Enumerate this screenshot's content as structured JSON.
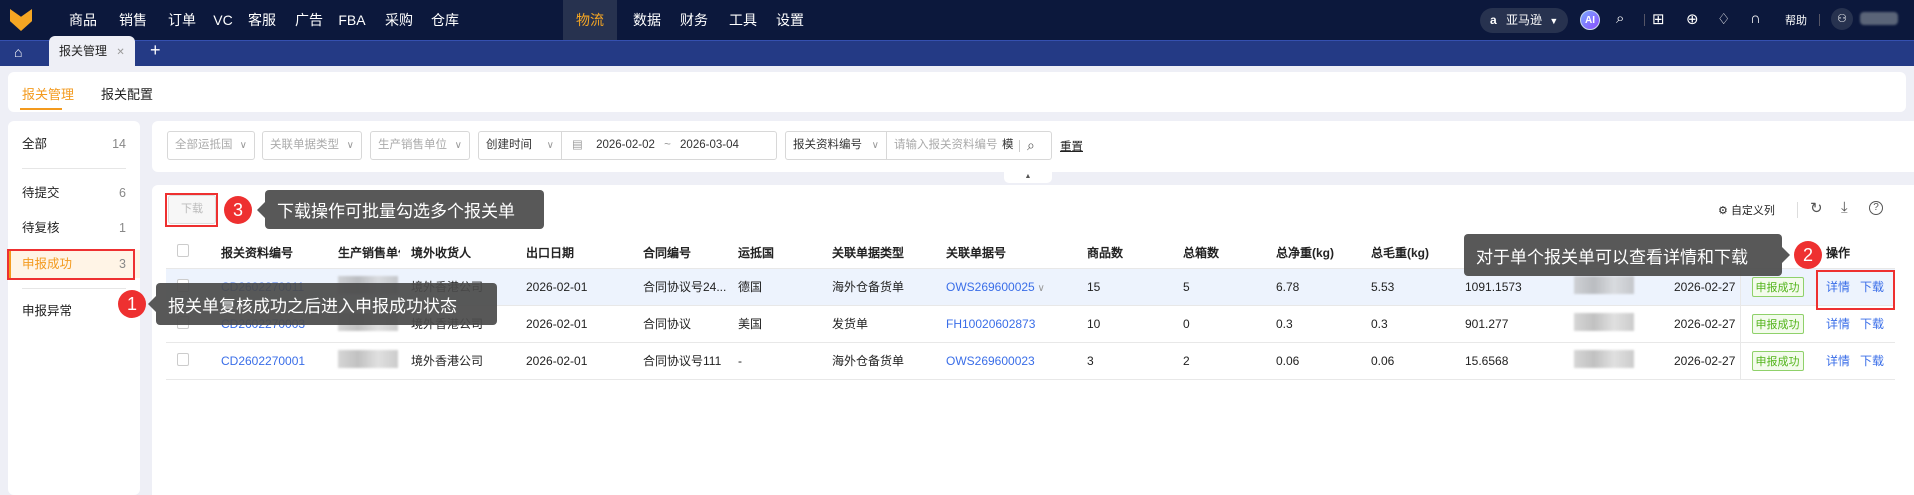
{
  "topnav": {
    "items": [
      "商品",
      "销售",
      "订单",
      "VC",
      "客服",
      "广告",
      "FBA",
      "采购",
      "仓库",
      "物流",
      "数据",
      "财务",
      "工具",
      "设置"
    ],
    "active": "物流",
    "platform": "亚马逊",
    "ai": "AI",
    "help": "帮助"
  },
  "tabs": {
    "open": "报关管理"
  },
  "subtabs": [
    "报关管理",
    "报关配置"
  ],
  "sidebar": [
    {
      "label": "全部",
      "count": "14"
    },
    {
      "label": "待提交",
      "count": "6"
    },
    {
      "label": "待复核",
      "count": "1"
    },
    {
      "label": "申报成功",
      "count": "3"
    },
    {
      "label": "申报异常",
      "count": ""
    }
  ],
  "filters": {
    "country": "全部运抵国",
    "doc_type": "关联单据类型",
    "unit": "生产销售单位",
    "time_field": "创建时间",
    "date_start": "2026-02-02",
    "date_sep": "~",
    "date_end": "2026-03-04",
    "search_field": "报关资料编号",
    "search_placeholder": "请输入报关资料编号",
    "fuzzy": "模",
    "reset": "重置"
  },
  "toolbar": {
    "download": "下载",
    "custom_columns": "自定义列"
  },
  "table": {
    "headers": [
      "报关资料编号",
      "生产销售单位",
      "境外收货人",
      "出口日期",
      "合同编号",
      "运抵国",
      "关联单据类型",
      "关联单据号",
      "商品数",
      "总箱数",
      "总净重(kg)",
      "总毛重(kg)",
      "",
      "",
      "",
      "",
      "操作"
    ],
    "rows": [
      {
        "id": "CD2602270011",
        "consignee": "境外香港公司",
        "date": "2026-02-01",
        "contract": "合同协议号24...",
        "country": "德国",
        "doc_type": "海外仓备货单",
        "doc_no": "OWS269600025",
        "items": "15",
        "boxes": "5",
        "net": "6.78",
        "gross": "5.53",
        "amount": "1091.1573",
        "created": "2026-02-27",
        "status": "申报成功"
      },
      {
        "id": "CD2602270003",
        "consignee": "境外香港公司",
        "date": "2026-02-01",
        "contract": "合同协议",
        "country": "美国",
        "doc_type": "发货单",
        "doc_no": "FH10020602873",
        "items": "10",
        "boxes": "0",
        "net": "0.3",
        "gross": "0.3",
        "amount": "901.277",
        "created": "2026-02-27",
        "status": "申报成功"
      },
      {
        "id": "CD2602270001",
        "consignee": "境外香港公司",
        "date": "2026-02-01",
        "contract": "合同协议号111",
        "country": "-",
        "doc_type": "海外仓备货单",
        "doc_no": "OWS269600023",
        "items": "3",
        "boxes": "2",
        "net": "0.06",
        "gross": "0.06",
        "amount": "15.6568",
        "created": "2026-02-27",
        "status": "申报成功"
      }
    ],
    "actions": {
      "detail": "详情",
      "download": "下载"
    }
  },
  "annotations": [
    {
      "num": "1",
      "text": "报关单复核成功之后进入申报成功状态"
    },
    {
      "num": "2",
      "text": "对于单个报关单可以查看详情和下载"
    },
    {
      "num": "3",
      "text": "下载操作可批量勾选多个报关单"
    }
  ],
  "colors": {
    "nav": "#0c183c",
    "tabbar": "#243a85",
    "accent": "#f39a1e",
    "link": "#3a6ee8",
    "annotation": "#ee3030"
  }
}
